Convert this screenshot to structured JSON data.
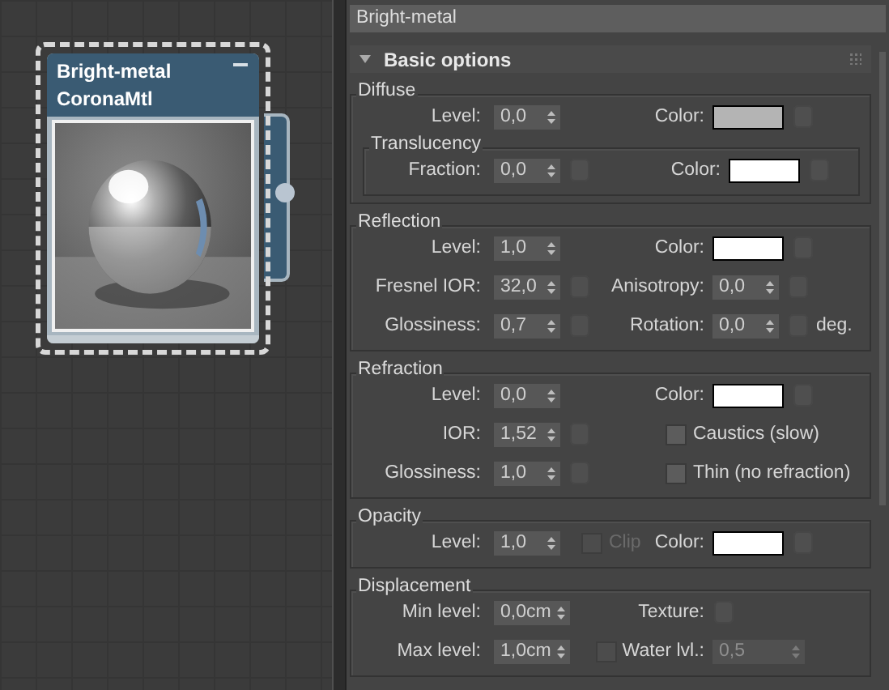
{
  "canvas": {
    "node": {
      "title": "Bright-metal",
      "subtitle": "CoronaMtl",
      "selected": true
    }
  },
  "editor": {
    "name_field": {
      "value": "Bright-metal"
    },
    "rollout": {
      "title": "Basic options",
      "expanded": true,
      "groups": [
        {
          "label": "Diffuse",
          "rows": [
            {
              "left": [
                {
                  "kind": "spinner",
                  "label": "Level:",
                  "value": "0,0",
                  "map": false
                }
              ],
              "right": [
                {
                  "kind": "color",
                  "label": "Color:",
                  "color": "#b4b4b4"
                }
              ]
            }
          ],
          "subgroups": [
            {
              "label": "Translucency",
              "rows": [
                {
                  "left": [
                    {
                      "kind": "spinner",
                      "label": "Fraction:",
                      "value": "0,0",
                      "map": true
                    }
                  ],
                  "right": [
                    {
                      "kind": "color",
                      "label": "Color:",
                      "color": "#ffffff"
                    }
                  ]
                }
              ]
            }
          ]
        },
        {
          "label": "Reflection",
          "rows": [
            {
              "left": [
                {
                  "kind": "spinner",
                  "label": "Level:",
                  "value": "1,0",
                  "map": false
                }
              ],
              "right": [
                {
                  "kind": "color",
                  "label": "Color:",
                  "color": "#ffffff"
                }
              ]
            },
            {
              "left": [
                {
                  "kind": "spinner",
                  "label": "Fresnel IOR:",
                  "value": "32,0",
                  "map": true
                }
              ],
              "right": [
                {
                  "kind": "spinner",
                  "label": "Anisotropy:",
                  "value": "0,0",
                  "map": true
                }
              ]
            },
            {
              "left": [
                {
                  "kind": "spinner",
                  "label": "Glossiness:",
                  "value": "0,7",
                  "map": true
                }
              ],
              "right": [
                {
                  "kind": "spinner",
                  "label": "Rotation:",
                  "value": "0,0",
                  "map": true,
                  "unit": "deg."
                }
              ]
            }
          ]
        },
        {
          "label": "Refraction",
          "rows": [
            {
              "left": [
                {
                  "kind": "spinner",
                  "label": "Level:",
                  "value": "0,0",
                  "map": false
                }
              ],
              "right": [
                {
                  "kind": "color",
                  "label": "Color:",
                  "color": "#ffffff"
                }
              ]
            },
            {
              "left": [
                {
                  "kind": "spinner",
                  "label": "IOR:",
                  "value": "1,52",
                  "map": true
                }
              ],
              "right": [
                {
                  "kind": "checkbox",
                  "label": "Caustics (slow)",
                  "checked": false,
                  "disabled": false
                }
              ]
            },
            {
              "left": [
                {
                  "kind": "spinner",
                  "label": "Glossiness:",
                  "value": "1,0",
                  "map": true
                }
              ],
              "right": [
                {
                  "kind": "checkbox",
                  "label": "Thin (no refraction)",
                  "checked": false,
                  "disabled": false
                }
              ]
            }
          ]
        },
        {
          "label": "Opacity",
          "rows": [
            {
              "left": [
                {
                  "kind": "spinner",
                  "label": "Level:",
                  "value": "1,0",
                  "map": false
                },
                {
                  "kind": "checkbox",
                  "label": "Clip",
                  "checked": false,
                  "disabled": true
                }
              ],
              "right": [
                {
                  "kind": "color",
                  "label": "Color:",
                  "color": "#ffffff"
                }
              ]
            }
          ]
        },
        {
          "label": "Displacement",
          "rows": [
            {
              "left": [
                {
                  "kind": "spinner",
                  "label": "Min level:",
                  "value": "0,0cm",
                  "map": false
                }
              ],
              "right": [
                {
                  "kind": "map",
                  "label": "Texture:"
                }
              ]
            },
            {
              "left": [
                {
                  "kind": "spinner",
                  "label": "Max level:",
                  "value": "1,0cm",
                  "map": false
                }
              ],
              "right": [
                {
                  "kind": "toggle_spinner",
                  "label": "Water lvl.:",
                  "checked": false,
                  "value": "0,5",
                  "disabled": true
                }
              ]
            }
          ]
        }
      ]
    }
  }
}
